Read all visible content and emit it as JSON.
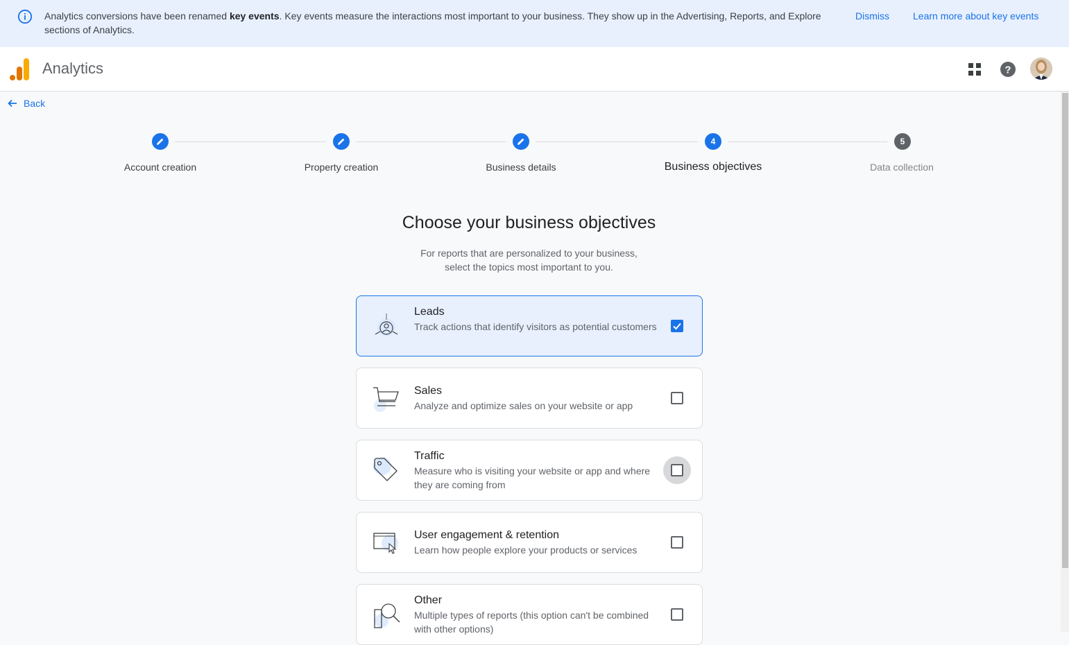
{
  "banner": {
    "text_before": "Analytics conversions have been renamed ",
    "text_bold": "key events",
    "text_after": ". Key events measure the interactions most important to your business. They show up in the Advertising, Reports, and Explore sections of Analytics.",
    "dismiss_label": "Dismiss",
    "learn_more_label": "Learn more about key events"
  },
  "header": {
    "app_title": "Analytics",
    "apps_icon": "grid-apps-icon",
    "help_icon": "help-icon"
  },
  "back_label": "Back",
  "stepper": {
    "steps": [
      {
        "label": "Account creation",
        "state": "done",
        "number": ""
      },
      {
        "label": "Property creation",
        "state": "done",
        "number": ""
      },
      {
        "label": "Business details",
        "state": "done",
        "number": ""
      },
      {
        "label": "Business objectives",
        "state": "active",
        "number": "4"
      },
      {
        "label": "Data collection",
        "state": "future",
        "number": "5"
      }
    ]
  },
  "main": {
    "title": "Choose your business objectives",
    "subtitle_line1": "For reports that are personalized to your business,",
    "subtitle_line2": "select the topics most important to you."
  },
  "objectives": [
    {
      "title": "Leads",
      "desc": "Track actions that identify visitors as potential customers",
      "checked": true,
      "icon": "leads-icon"
    },
    {
      "title": "Sales",
      "desc": "Analyze and optimize sales on your website or app",
      "checked": false,
      "icon": "shopping-cart-icon"
    },
    {
      "title": "Traffic",
      "desc": "Measure who is visiting your website or app and where they are coming from",
      "checked": false,
      "icon": "tag-icon"
    },
    {
      "title": "User engagement & retention",
      "desc": "Learn how people explore your products or services",
      "checked": false,
      "icon": "browser-cursor-icon"
    },
    {
      "title": "Other",
      "desc": "Multiple types of reports (this option can't be combined with other options)",
      "checked": false,
      "icon": "magnifier-icon"
    }
  ],
  "colors": {
    "accent": "#1a73e8",
    "banner_bg": "#e8f0fe",
    "logo_orange": "#f9ab00",
    "logo_dark_orange": "#e37400"
  }
}
